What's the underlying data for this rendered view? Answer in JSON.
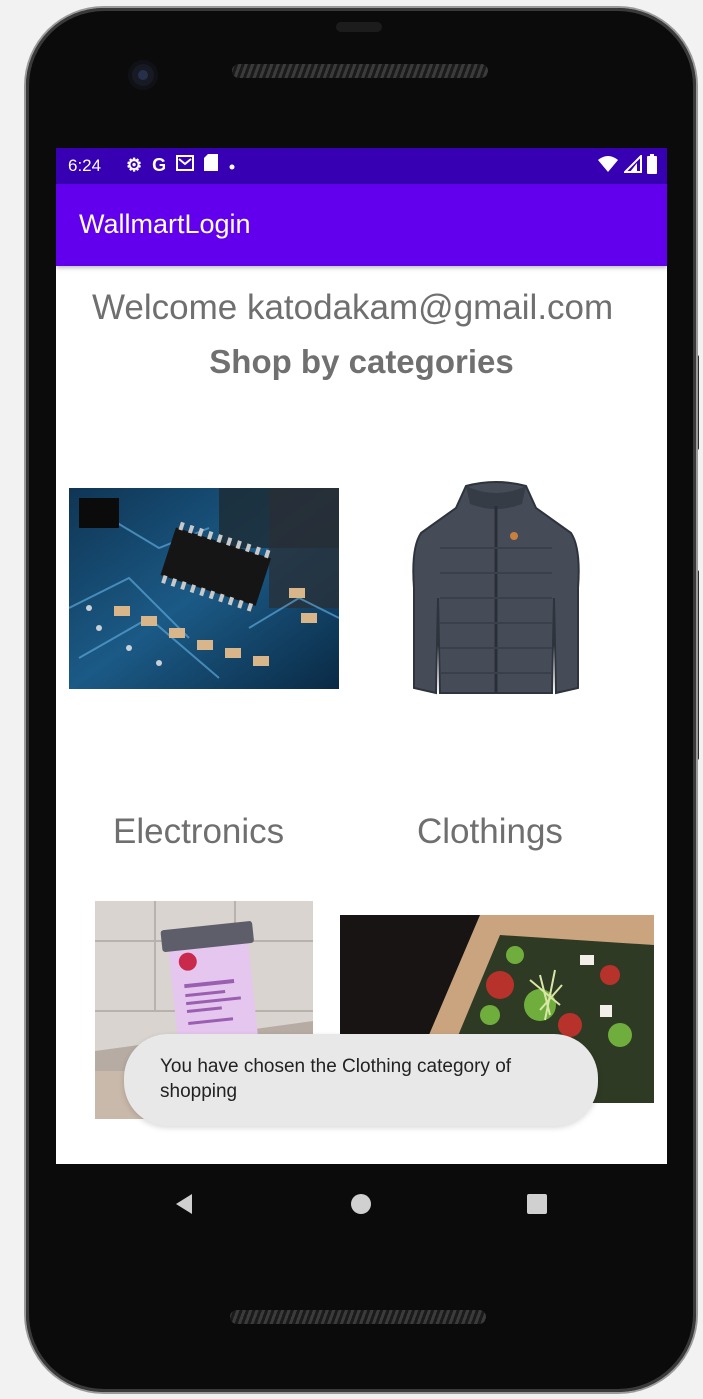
{
  "status_bar": {
    "time": "6:24",
    "left_icons": [
      "gear-icon",
      "google-icon",
      "gmail-icon",
      "sd-card-icon",
      "dot-icon"
    ],
    "right_icons": [
      "wifi-icon",
      "signal-icon",
      "battery-icon"
    ],
    "left_glyphs": {
      "gear": "⚙",
      "google": "G"
    }
  },
  "app_bar": {
    "title": "WallmartLogin",
    "color": "#6200ee",
    "status_color": "#3700b3"
  },
  "main": {
    "welcome": "Welcome katodakam@gmail.com",
    "section_title": "Shop by categories",
    "categories": [
      {
        "label": "Electronics",
        "image": "circuit-board-photo"
      },
      {
        "label": "Clothings",
        "image": "jacket-photo"
      },
      {
        "label": "",
        "image": "skincare-tube-photo"
      },
      {
        "label": "",
        "image": "salad-bowl-photo"
      }
    ]
  },
  "toast": {
    "message": "You have chosen the Clothing category of shopping"
  },
  "nav_bar": {
    "items": [
      "back-icon",
      "home-icon",
      "recents-icon"
    ]
  }
}
